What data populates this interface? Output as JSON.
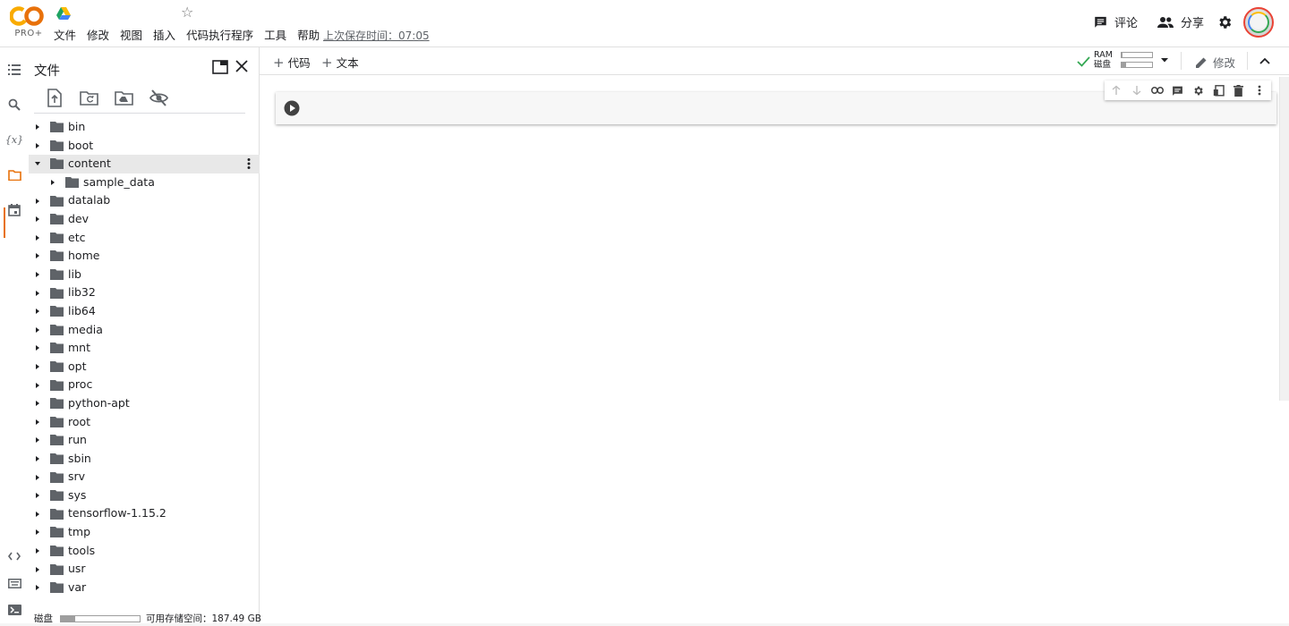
{
  "header": {
    "logo_text": "CO",
    "plan_label": "PRO+",
    "menu": [
      "文件",
      "修改",
      "视图",
      "插入",
      "代码执行程序",
      "工具",
      "帮助"
    ],
    "last_saved": "上次保存时间：07:05",
    "comment_label": "评论",
    "share_label": "分享",
    "icons": {
      "drive": "google-drive-icon",
      "star": "star-icon",
      "comment": "comment-icon",
      "share": "people-icon",
      "settings": "gear-icon"
    }
  },
  "rail": {
    "items": [
      "toc-icon",
      "search-icon",
      "variables-icon",
      "folder-icon",
      "calendar-icon"
    ],
    "bottom_items": [
      "code-icon",
      "keyboard-icon",
      "terminal-icon"
    ],
    "variables_glyph": "{x}",
    "active_color": "#e8710a"
  },
  "files": {
    "title": "文件",
    "toolbar": [
      "upload-file-icon",
      "refresh-folder-icon",
      "mount-drive-icon",
      "hide-files-icon"
    ],
    "tree": [
      {
        "name": "bin",
        "level": 0,
        "expanded": false
      },
      {
        "name": "boot",
        "level": 0,
        "expanded": false
      },
      {
        "name": "content",
        "level": 0,
        "expanded": true,
        "selected": true
      },
      {
        "name": "sample_data",
        "level": 1,
        "expanded": false
      },
      {
        "name": "datalab",
        "level": 0,
        "expanded": false
      },
      {
        "name": "dev",
        "level": 0,
        "expanded": false
      },
      {
        "name": "etc",
        "level": 0,
        "expanded": false
      },
      {
        "name": "home",
        "level": 0,
        "expanded": false
      },
      {
        "name": "lib",
        "level": 0,
        "expanded": false
      },
      {
        "name": "lib32",
        "level": 0,
        "expanded": false
      },
      {
        "name": "lib64",
        "level": 0,
        "expanded": false
      },
      {
        "name": "media",
        "level": 0,
        "expanded": false
      },
      {
        "name": "mnt",
        "level": 0,
        "expanded": false
      },
      {
        "name": "opt",
        "level": 0,
        "expanded": false
      },
      {
        "name": "proc",
        "level": 0,
        "expanded": false
      },
      {
        "name": "python-apt",
        "level": 0,
        "expanded": false
      },
      {
        "name": "root",
        "level": 0,
        "expanded": false
      },
      {
        "name": "run",
        "level": 0,
        "expanded": false
      },
      {
        "name": "sbin",
        "level": 0,
        "expanded": false
      },
      {
        "name": "srv",
        "level": 0,
        "expanded": false
      },
      {
        "name": "sys",
        "level": 0,
        "expanded": false
      },
      {
        "name": "tensorflow-1.15.2",
        "level": 0,
        "expanded": false
      },
      {
        "name": "tmp",
        "level": 0,
        "expanded": false
      },
      {
        "name": "tools",
        "level": 0,
        "expanded": false
      },
      {
        "name": "usr",
        "level": 0,
        "expanded": false
      },
      {
        "name": "var",
        "level": 0,
        "expanded": false
      }
    ],
    "disk_label": "磁盘",
    "disk_usage_fraction": 0.18,
    "disk_free": "可用存储空间：187.49 GB"
  },
  "notebook": {
    "add_code": "代码",
    "add_text": "文本",
    "ram_label": "RAM",
    "disk_label": "磁盘",
    "ram_fraction": 0.03,
    "disk_fraction": 0.15,
    "edit_label": "修改",
    "connected_color": "#34a853",
    "cell_toolbar": [
      "arrow-up-icon",
      "arrow-down-icon",
      "link-icon",
      "comment-icon",
      "gear-icon",
      "mirror-cell-icon",
      "delete-icon",
      "more-vert-icon"
    ]
  }
}
